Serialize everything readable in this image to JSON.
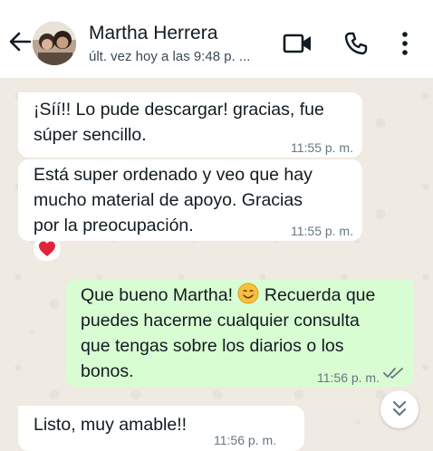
{
  "header": {
    "contact_name": "Martha Herrera",
    "last_seen": "últ. vez hoy a las 9:48 p. ..."
  },
  "icons": {
    "back": "arrow-back-icon",
    "video": "video-call-icon",
    "call": "phone-icon",
    "menu": "more-vertical-icon",
    "reaction": "red-heart-icon",
    "read": "double-check-icon",
    "scroll": "double-chevron-down-icon"
  },
  "colors": {
    "incoming_bubble": "#ffffff",
    "outgoing_bubble": "#d9fdd3",
    "chat_background": "#efeae2",
    "reaction_heart": "#e0243a"
  },
  "messages": [
    {
      "direction": "incoming",
      "text": "¡Síí!! Lo pude descargar! gracias, fue\nsúper sencillo.",
      "time": "11:55 p. m."
    },
    {
      "direction": "incoming",
      "text": "Está super ordenado y veo que hay\nmucho material de apoyo. Gracias\npor la preocupación.",
      "time": "11:55 p. m.",
      "reaction": "❤️"
    },
    {
      "direction": "outgoing",
      "text_before_emoji": "Que bueno Martha! ",
      "emoji": "😊",
      "text_after_emoji": " Recuerda que\npuedes hacerme cualquier consulta\nque tengas sobre los diarios o los\nbonos.",
      "time": "11:56 p. m.",
      "status": "read"
    },
    {
      "direction": "incoming",
      "text": "Listo, muy amable!!",
      "time": "11:56 p. m."
    }
  ]
}
